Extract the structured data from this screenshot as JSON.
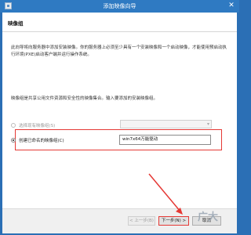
{
  "window": {
    "title": "添加映像向导",
    "close_glyph": "✕"
  },
  "header": {
    "title": "映像组"
  },
  "content": {
    "intro_text": "此向导将向服务器中添加安装映像。你的服务器上必须至少具有一个安装映像和一个启动映像，才能使用预启动执行环境(PXE)启动客户端并运行操作系统。",
    "description": "映像组是共享公用文件资源和安全性的映像集合。输入要添加的安装映像组。",
    "option_existing_label": "选择现有映像组(S)",
    "option_new_label": "创建已命名的映像组(C)",
    "new_group_value": "win7x64万能驱动"
  },
  "footer": {
    "prev_label": "< 上一步(B)",
    "next_label": "下一步(N) >",
    "cancel_label": "取消"
  },
  "colors": {
    "annotation": "#e53935"
  }
}
